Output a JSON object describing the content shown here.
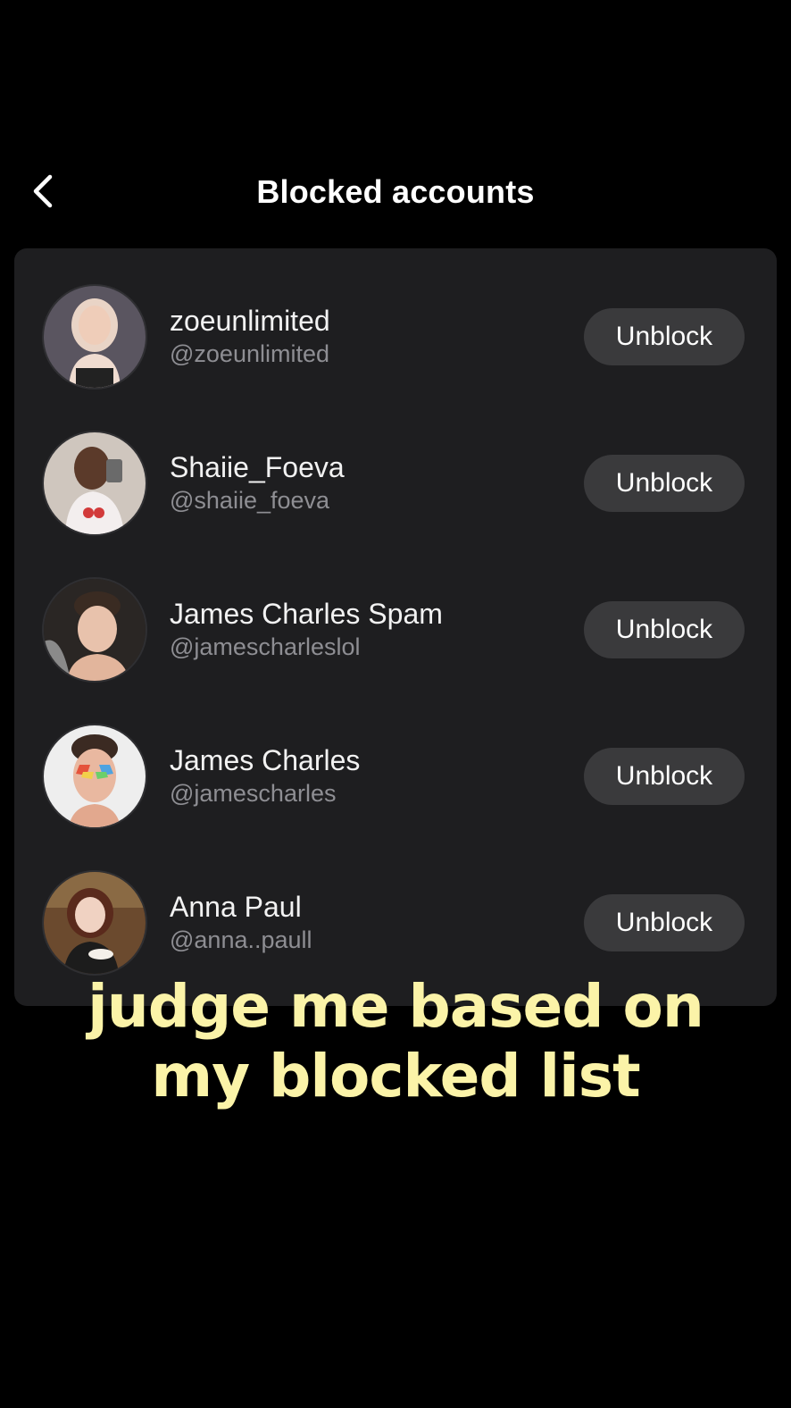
{
  "header": {
    "title": "Blocked accounts",
    "back_icon": "chevron-left-icon"
  },
  "accounts": [
    {
      "name": "zoeunlimited",
      "handle": "@zoeunlimited",
      "button": "Unblock",
      "avatar_colors": [
        "#5a5560",
        "#e8c6b6",
        "#f2e6dc"
      ]
    },
    {
      "name": "Shaiie_Foeva",
      "handle": "@shaiie_foeva",
      "button": "Unblock",
      "avatar_colors": [
        "#cfc6be",
        "#5b3a2a",
        "#f1eeee"
      ]
    },
    {
      "name": "James Charles Spam",
      "handle": "@jamescharleslol",
      "button": "Unblock",
      "avatar_colors": [
        "#2a2624",
        "#e8c2ac",
        "#3a2b22"
      ]
    },
    {
      "name": "James Charles",
      "handle": "@jamescharles",
      "button": "Unblock",
      "avatar_colors": [
        "#eeeeee",
        "#e9b8a0",
        "#3b2a22"
      ]
    },
    {
      "name": "Anna Paul",
      "handle": "@anna..paull",
      "button": "Unblock",
      "avatar_colors": [
        "#6b4a2e",
        "#f0d2c2",
        "#5a2a1c"
      ]
    }
  ],
  "caption": {
    "line1": "judge me based on",
    "line2": "my blocked list"
  },
  "colors": {
    "background": "#000000",
    "panel": "#1e1e20",
    "button": "#3a3a3c",
    "handle": "#8e8e93",
    "caption": "#fbf3a8"
  }
}
